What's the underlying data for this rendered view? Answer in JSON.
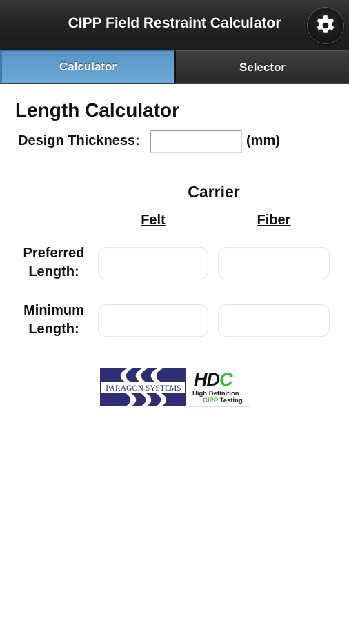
{
  "header": {
    "title": "CIPP Field Restraint Calculator",
    "settings_icon": "gear-icon"
  },
  "tabs": [
    {
      "label": "Calculator",
      "active": true
    },
    {
      "label": "Selector",
      "active": false
    }
  ],
  "colors": {
    "header_bg": "#262626",
    "active_tab": "#5f9ecf",
    "inactive_tab": "#333333",
    "hdc_green": "#2fc02f",
    "paragon_navy": "#2d2e73"
  },
  "main": {
    "title": "Length Calculator",
    "design_thickness": {
      "label": "Design Thickness:",
      "value": "",
      "placeholder": "",
      "unit": "(mm)"
    },
    "carrier_label": "Carrier",
    "columns": [
      "Felt",
      "Fiber"
    ],
    "rows": [
      {
        "label_line1": "Preferred",
        "label_line2": "Length:",
        "felt_value": "",
        "fiber_value": ""
      },
      {
        "label_line1": "Minimum",
        "label_line2": "Length:",
        "felt_value": "",
        "fiber_value": ""
      }
    ]
  },
  "logos": {
    "paragon": {
      "text": "PARAGON SYSTEMS"
    },
    "hdc": {
      "mark_hd": "HD",
      "mark_c": "C",
      "line1": "High Definition",
      "line2_green": "CIPP",
      "line2_rest": " Testing"
    }
  }
}
